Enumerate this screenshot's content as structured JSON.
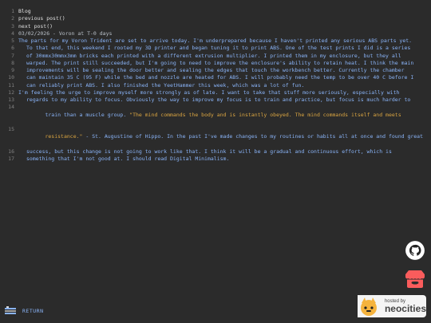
{
  "editor": {
    "lines": [
      {
        "n": "1",
        "text": "Blog",
        "cls": "title"
      },
      {
        "n": "2",
        "text": "previous post()",
        "cls": ""
      },
      {
        "n": "3",
        "text": "next post()",
        "cls": ""
      },
      {
        "n": "4",
        "text": "03/02/2026 - Voron at T-0 days",
        "cls": "date"
      },
      {
        "n": "5",
        "text": "The parts for my Voron Trident are set to arrive today. I'm underprepared because I haven't printed any serious ABS parts yet.",
        "cls": "blue"
      },
      {
        "n": "6",
        "text": "To that end, this weekend I rooted my 3D printer and began tuning it to print ABS. One of the test prints I did is a series",
        "cls": "blue indent"
      },
      {
        "n": "7",
        "text": "of 30mmx30mmx3mm bricks each printed with a different extrusion multiplier. I printed them in my enclosure, but they all",
        "cls": "blue indent"
      },
      {
        "n": "8",
        "text": "warped. The print still succeeded, but I'm going to need to improve the enclosure's ability to retain heat. I think the main",
        "cls": "blue indent"
      },
      {
        "n": "9",
        "text": "improvements will be sealing the door better and sealing the edges that touch the workbench better. Currently the chamber",
        "cls": "blue indent"
      },
      {
        "n": "10",
        "text": "can maintain 35 C (95 F) while the bed and nozzle are heated for ABS. I will probably need the temp to be over 40 C before I",
        "cls": "blue indent"
      },
      {
        "n": "11",
        "text": "can reliably print ABS. I also finished the YeetHammer this week, which was a lot of fun.",
        "cls": "blue indent"
      },
      {
        "n": "12",
        "text": "I'm feeling the urge to improve myself more strongly as of late. I want to take that stuff more seriously, especially with",
        "cls": "blue"
      },
      {
        "n": "13",
        "text": "regards to my ability to focus. Obviously the way to improve my focus is to train and practice, but focus is much harder to",
        "cls": "blue indent"
      },
      {
        "n": "14",
        "text": "train than a muscle group. ",
        "quote": "\"The mind commands the body and is instantly obeyed. The mind commands itself and meets",
        "cls": "blue indent"
      },
      {
        "n": "15",
        "text": "",
        "quote": "resistance.\"",
        "after": " - St. Augustine of Hippo. In the past I've made changes to my routines or habits all at once and found great",
        "cls": "blue indent"
      },
      {
        "n": "16",
        "text": "success, but this change is not going to work like that. I think it will be a gradual and continuous effort, which is",
        "cls": "blue indent"
      },
      {
        "n": "17",
        "text": "something that I'm not good at. I should read Digital Minimalism.",
        "cls": "blue indent"
      }
    ]
  },
  "icons": {
    "github": "github-icon",
    "itch": "itchio-icon"
  },
  "footer": {
    "return_label": "RETURN",
    "neocities_small": "hosted by",
    "neocities_big": "neocities"
  }
}
